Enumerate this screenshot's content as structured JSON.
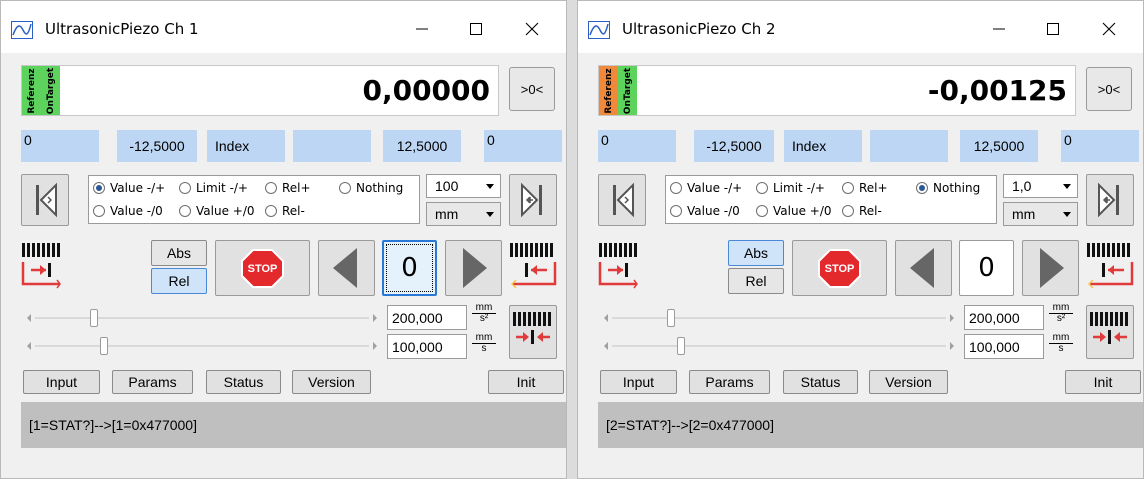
{
  "windows": [
    {
      "title": "UltrasonicPiezo Ch 1",
      "tags": {
        "referenz": "Referenz",
        "ontarget": "OnTarget",
        "referenz_color": "#5dd35d",
        "ontarget_color": "#5dd35d"
      },
      "position": "0,00000",
      "zero_label": ">0<",
      "limits": {
        "corner_left": "0",
        "min": "-12,5000",
        "index": "Index",
        "max": "12,5000",
        "corner_right": "0"
      },
      "radios": [
        {
          "label": "Value -/+",
          "checked": true
        },
        {
          "label": "Limit -/+",
          "checked": false
        },
        {
          "label": "Rel+",
          "checked": false
        },
        {
          "label": "Nothing",
          "checked": false
        },
        {
          "label": "Value -/0",
          "checked": false
        },
        {
          "label": "Value +/0",
          "checked": false
        },
        {
          "label": "Rel-",
          "checked": false
        }
      ],
      "step": "100",
      "unit": "mm",
      "abs_label": "Abs",
      "rel_label": "Rel",
      "abs_active": false,
      "stop_label": "STOP",
      "step_count": "0",
      "step_count_focused": true,
      "accel": "200,000",
      "accel_unit_num": "mm",
      "accel_unit_den": "s²",
      "velocity": "100,000",
      "vel_unit_num": "mm",
      "vel_unit_den": "s",
      "accel_slider": 0.17,
      "velocity_slider": 0.2,
      "buttons": {
        "input": "Input",
        "params": "Params",
        "status": "Status",
        "version": "Version",
        "init": "Init"
      },
      "log": "[1=STAT?]-->[1=0x477000]"
    },
    {
      "title": "UltrasonicPiezo Ch 2",
      "tags": {
        "referenz": "Referenz",
        "ontarget": "OnTarget",
        "referenz_color": "#f08a3a",
        "ontarget_color": "#5dd35d"
      },
      "position": "-0,00125",
      "zero_label": ">0<",
      "limits": {
        "corner_left": "0",
        "min": "-12,5000",
        "index": "Index",
        "max": "12,5000",
        "corner_right": "0"
      },
      "radios": [
        {
          "label": "Value -/+",
          "checked": false
        },
        {
          "label": "Limit -/+",
          "checked": false
        },
        {
          "label": "Rel+",
          "checked": false
        },
        {
          "label": "Nothing",
          "checked": true
        },
        {
          "label": "Value -/0",
          "checked": false
        },
        {
          "label": "Value +/0",
          "checked": false
        },
        {
          "label": "Rel-",
          "checked": false
        }
      ],
      "step": "1,0",
      "unit": "mm",
      "abs_label": "Abs",
      "rel_label": "Rel",
      "abs_active": true,
      "stop_label": "STOP",
      "step_count": "0",
      "step_count_focused": false,
      "accel": "200,000",
      "accel_unit_num": "mm",
      "accel_unit_den": "s²",
      "velocity": "100,000",
      "vel_unit_num": "mm",
      "vel_unit_den": "s",
      "accel_slider": 0.17,
      "velocity_slider": 0.2,
      "buttons": {
        "input": "Input",
        "params": "Params",
        "status": "Status",
        "version": "Version",
        "init": "Init"
      },
      "log": "[2=STAT?]-->[2=0x477000]"
    }
  ],
  "icons": {
    "app": "chart-line-icon",
    "minimize": "minimize-icon",
    "maximize": "maximize-icon",
    "close": "close-icon",
    "home_left": "step-to-start-icon",
    "home_right": "step-to-end-icon",
    "ref_left": "reference-move-negative-icon",
    "ref_right": "reference-move-positive-icon",
    "ref_center": "reference-center-icon",
    "stop": "stop-sign-icon",
    "prev": "triangle-left-icon",
    "next": "triangle-right-icon"
  }
}
